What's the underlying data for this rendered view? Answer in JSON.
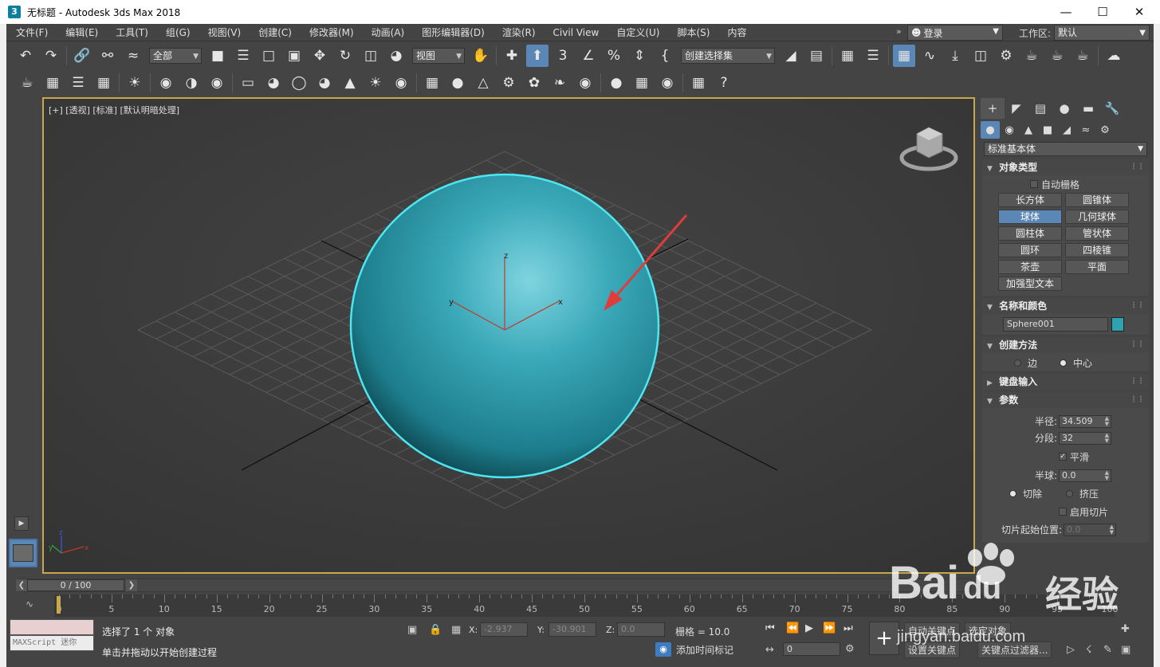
{
  "window": {
    "title": "无标题 - Autodesk 3ds Max 2018",
    "app_icon": "3",
    "controls": [
      "—",
      "☐",
      "✕"
    ]
  },
  "menu": {
    "items": [
      "文件(F)",
      "编辑(E)",
      "工具(T)",
      "组(G)",
      "视图(V)",
      "创建(C)",
      "修改器(M)",
      "动画(A)",
      "图形编辑器(D)",
      "渲染(R)",
      "Civil View",
      "自定义(U)",
      "脚本(S)",
      "内容"
    ],
    "overflow": "»",
    "login": "登录",
    "workspace_label": "工作区:",
    "workspace_value": "默认"
  },
  "toolbar1": {
    "selection_filter": "全部",
    "ref_coord": "视图",
    "named_selection": "创建选择集"
  },
  "viewport": {
    "label": "[+] [透视] [标准] [默认明暗处理]",
    "axis_labels": {
      "x": "x",
      "y": "y",
      "z": "z"
    },
    "object_color": "#2fa2b2",
    "selection_outline": "#4ee6f0",
    "arrow_color": "#e03c3c"
  },
  "command_panel": {
    "category": "标准基本体",
    "object_type": {
      "title": "对象类型",
      "autogrid": "自动栅格",
      "buttons": [
        "长方体",
        "圆锥体",
        "球体",
        "几何球体",
        "圆柱体",
        "管状体",
        "圆环",
        "四棱锥",
        "茶壶",
        "平面",
        "加强型文本"
      ],
      "active_index": 2
    },
    "name_color": {
      "title": "名称和颜色",
      "name": "Sphere001",
      "color": "#2fa2b2"
    },
    "creation_method": {
      "title": "创建方法",
      "options": [
        "边",
        "中心"
      ],
      "selected": "中心"
    },
    "keyboard_entry": {
      "title": "键盘输入"
    },
    "parameters": {
      "title": "参数",
      "radius_label": "半径:",
      "radius": "34.509",
      "segments_label": "分段:",
      "segments": "32",
      "smooth_label": "平滑",
      "smooth_checked": true,
      "hemisphere_label": "半球:",
      "hemisphere": "0.0",
      "chop_label": "切除",
      "squash_label": "挤压",
      "slice_on_label": "启用切片",
      "slice_from_label": "切片起始位置:",
      "slice_from": "0.0"
    }
  },
  "timeline": {
    "slider_text": "0 / 100",
    "ticks": [
      0,
      5,
      10,
      15,
      20,
      25,
      30,
      35,
      40,
      45,
      50,
      55,
      60,
      65,
      70,
      75,
      80,
      85,
      90,
      95,
      100
    ]
  },
  "status": {
    "maxscript": "MAXScript 迷你",
    "selected": "选择了 1 个 对象",
    "prompt": "单击并拖动以开始创建过程",
    "x_label": "X:",
    "x": "-2.937",
    "y_label": "Y:",
    "y": "-30.901",
    "z_label": "Z:",
    "z": "0.0",
    "grid": "栅格 = 10.0",
    "add_time_tag": "添加时间标记",
    "frame": "0",
    "auto_key": "自动关键点",
    "set_key": "设置关键点",
    "selected_obj": "选定对象",
    "key_filters": "关键点过滤器..."
  },
  "watermark": {
    "brand": "Bai",
    "brand2": "du",
    "cn": "经验",
    "url": "jingyan.baidu.com"
  }
}
